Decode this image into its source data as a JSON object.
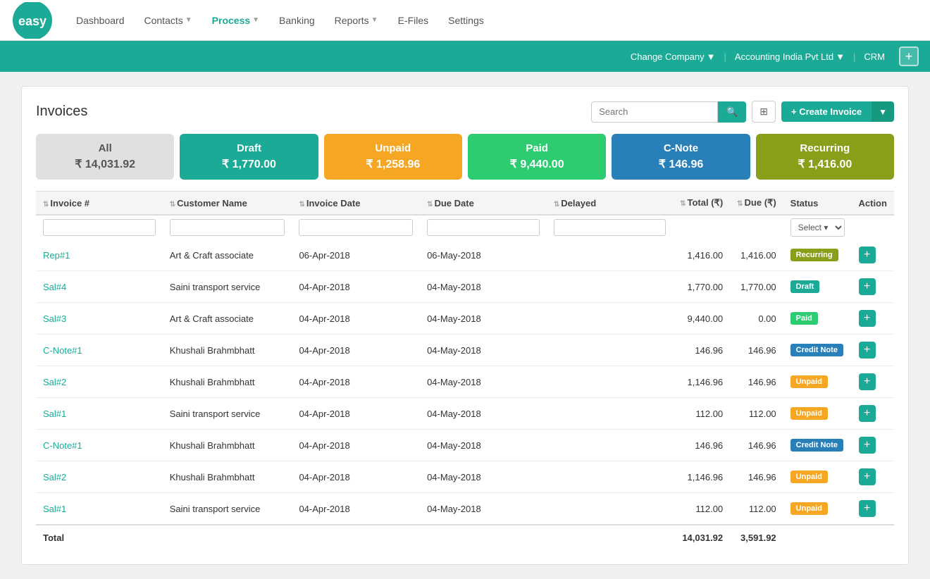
{
  "app": {
    "logo_text": "easy",
    "logo_bg": "#1aaa96"
  },
  "nav": {
    "items": [
      {
        "label": "Dashboard",
        "active": false,
        "has_dropdown": false
      },
      {
        "label": "Contacts",
        "active": false,
        "has_dropdown": true
      },
      {
        "label": "Process",
        "active": true,
        "has_dropdown": true
      },
      {
        "label": "Banking",
        "active": false,
        "has_dropdown": false
      },
      {
        "label": "Reports",
        "active": false,
        "has_dropdown": true
      },
      {
        "label": "E-Files",
        "active": false,
        "has_dropdown": false
      },
      {
        "label": "Settings",
        "active": false,
        "has_dropdown": false
      }
    ]
  },
  "company_bar": {
    "change_company_label": "Change Company",
    "company_name": "Accounting India Pvt Ltd",
    "crm_label": "CRM",
    "plus_label": "+"
  },
  "page": {
    "title": "Invoices"
  },
  "search": {
    "placeholder": "Search"
  },
  "buttons": {
    "search_icon": "🔍",
    "grid_icon": "⊞",
    "create_invoice": "+ Create Invoice",
    "dropdown_arrow": "▼"
  },
  "status_tabs": [
    {
      "label": "All",
      "amount": "₹ 14,031.92",
      "class": "tab-all"
    },
    {
      "label": "Draft",
      "amount": "₹ 1,770.00",
      "class": "tab-draft"
    },
    {
      "label": "Unpaid",
      "amount": "₹ 1,258.96",
      "class": "tab-unpaid"
    },
    {
      "label": "Paid",
      "amount": "₹ 9,440.00",
      "class": "tab-paid"
    },
    {
      "label": "C-Note",
      "amount": "₹ 146.96",
      "class": "tab-cnote"
    },
    {
      "label": "Recurring",
      "amount": "₹ 1,416.00",
      "class": "tab-recurring"
    }
  ],
  "table": {
    "columns": [
      {
        "label": "Invoice #",
        "sortable": true
      },
      {
        "label": "Customer Name",
        "sortable": true
      },
      {
        "label": "Invoice Date",
        "sortable": true
      },
      {
        "label": "Due Date",
        "sortable": true
      },
      {
        "label": "Delayed",
        "sortable": true
      },
      {
        "label": "Total (₹)",
        "sortable": true
      },
      {
        "label": "Due (₹)",
        "sortable": true
      },
      {
        "label": "Status",
        "sortable": false
      },
      {
        "label": "Action",
        "sortable": false
      }
    ],
    "filter_select_placeholder": "Select ▾",
    "rows": [
      {
        "invoice": "Rep#1",
        "customer": "Art & Craft associate",
        "invoice_date": "06-Apr-2018",
        "due_date": "06-May-2018",
        "delayed": "",
        "total": "1,416.00",
        "due": "1,416.00",
        "status": "Recurring",
        "status_class": "badge-recurring"
      },
      {
        "invoice": "Sal#4",
        "customer": "Saini transport service",
        "invoice_date": "04-Apr-2018",
        "due_date": "04-May-2018",
        "delayed": "",
        "total": "1,770.00",
        "due": "1,770.00",
        "status": "Draft",
        "status_class": "badge-draft"
      },
      {
        "invoice": "Sal#3",
        "customer": "Art & Craft associate",
        "invoice_date": "04-Apr-2018",
        "due_date": "04-May-2018",
        "delayed": "",
        "total": "9,440.00",
        "due": "0.00",
        "status": "Paid",
        "status_class": "badge-paid"
      },
      {
        "invoice": "C-Note#1",
        "customer": "Khushali Brahmbhatt",
        "invoice_date": "04-Apr-2018",
        "due_date": "04-May-2018",
        "delayed": "",
        "total": "146.96",
        "due": "146.96",
        "status": "Credit Note",
        "status_class": "badge-credit-note"
      },
      {
        "invoice": "Sal#2",
        "customer": "Khushali Brahmbhatt",
        "invoice_date": "04-Apr-2018",
        "due_date": "04-May-2018",
        "delayed": "",
        "total": "1,146.96",
        "due": "146.96",
        "status": "Unpaid",
        "status_class": "badge-unpaid"
      },
      {
        "invoice": "Sal#1",
        "customer": "Saini transport service",
        "invoice_date": "04-Apr-2018",
        "due_date": "04-May-2018",
        "delayed": "",
        "total": "112.00",
        "due": "112.00",
        "status": "Unpaid",
        "status_class": "badge-unpaid"
      },
      {
        "invoice": "C-Note#1",
        "customer": "Khushali Brahmbhatt",
        "invoice_date": "04-Apr-2018",
        "due_date": "04-May-2018",
        "delayed": "",
        "total": "146.96",
        "due": "146.96",
        "status": "Credit Note",
        "status_class": "badge-credit-note"
      },
      {
        "invoice": "Sal#2",
        "customer": "Khushali Brahmbhatt",
        "invoice_date": "04-Apr-2018",
        "due_date": "04-May-2018",
        "delayed": "",
        "total": "1,146.96",
        "due": "146.96",
        "status": "Unpaid",
        "status_class": "badge-unpaid"
      },
      {
        "invoice": "Sal#1",
        "customer": "Saini transport service",
        "invoice_date": "04-Apr-2018",
        "due_date": "04-May-2018",
        "delayed": "",
        "total": "112.00",
        "due": "112.00",
        "status": "Unpaid",
        "status_class": "badge-unpaid"
      }
    ],
    "total_row": {
      "label": "Total",
      "total_amount": "14,031.92",
      "due_amount": "3,591.92"
    }
  }
}
